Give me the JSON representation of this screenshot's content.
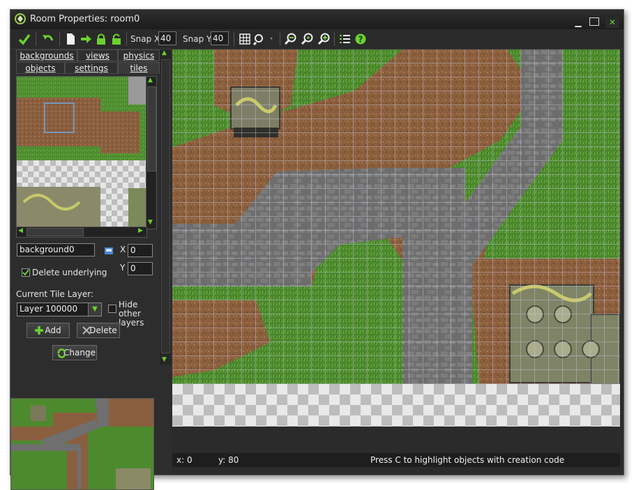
{
  "window": {
    "title": "Room Properties: room0",
    "controls": {
      "minimize": "▬",
      "maximize": "■",
      "close": "✕"
    }
  },
  "toolbar": {
    "icons": [
      "ok-checkmark-icon",
      "undo-icon",
      "new-file-icon",
      "shift-arrow-icon",
      "lock-icon",
      "unlock-icon",
      "grid-toggle-icon",
      "zoom-dropdown-icon",
      "zoom-out-icon",
      "zoom-reset-icon",
      "zoom-in-icon",
      "list-icon",
      "help-icon"
    ],
    "snap_x_label": "Snap X:",
    "snap_x_value": "40",
    "snap_y_label": "Snap Y:",
    "snap_y_value": "40"
  },
  "tabs": {
    "row1": [
      "backgrounds",
      "views",
      "physics"
    ],
    "row2": [
      "objects",
      "settings",
      "tiles"
    ],
    "active": "tiles"
  },
  "tile_panel": {
    "background_name": "background0",
    "x_label": "X",
    "x_value": "0",
    "y_label": "Y",
    "y_value": "0",
    "delete_underlying_label": "Delete underlying",
    "delete_underlying_checked": true,
    "current_tile_layer_label": "Current Tile Layer:",
    "layer_value": "Layer 100000",
    "hide_other_layers_label": "Hide other layers",
    "hide_other_layers_checked": false,
    "add_label": "Add",
    "delete_label": "Delete",
    "change_label": "Change"
  },
  "status": {
    "x": "x: 0",
    "y": "y: 80",
    "message": "Press C to highlight objects with creation code"
  },
  "colors": {
    "grass": "#4d8a2e",
    "dirt": "#8a5f3f",
    "stone": "#6e6e6e",
    "grid": "#c8c8e0",
    "accent_green": "#5bbf2e"
  }
}
